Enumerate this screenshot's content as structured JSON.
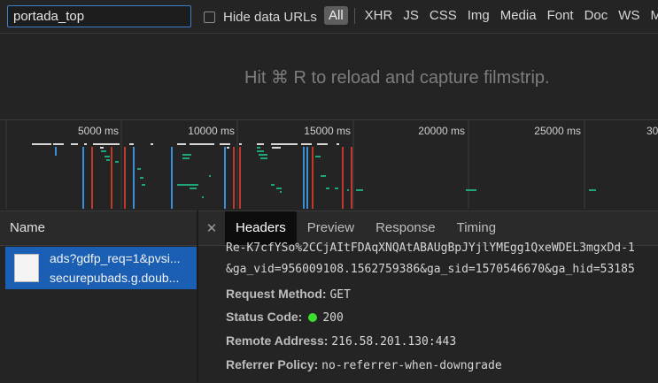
{
  "filter": {
    "value": "portada_top"
  },
  "hide_data_urls": {
    "label": "Hide data URLs",
    "checked": false
  },
  "resource_types": [
    "All",
    "XHR",
    "JS",
    "CSS",
    "Img",
    "Media",
    "Font",
    "Doc",
    "WS",
    "M"
  ],
  "filmstrip": {
    "message": "Hit ⌘ R to reload and capture filmstrip."
  },
  "timeline": {
    "ticks": [
      "5000 ms",
      "10000 ms",
      "15000 ms",
      "20000 ms",
      "25000 ms",
      "30"
    ]
  },
  "request_list": {
    "header": "Name",
    "selected": {
      "name": "ads?gdfp_req=1&pvsi...",
      "domain": "securepubads.g.doub..."
    }
  },
  "tabs": [
    "Headers",
    "Preview",
    "Response",
    "Timing"
  ],
  "active_tab": "Headers",
  "headers": {
    "url_fragment_1": "Re-K7cfYSo%2CCjAItFDAqXNQAtABAUgBpJYjlYMEgg1QxeWDEL3mgxDd-1",
    "url_fragment_2": "&ga_vid=956009108.1562759386&ga_sid=1570546670&ga_hid=53185",
    "request_method": {
      "label": "Request Method:",
      "value": "GET"
    },
    "status_code": {
      "label": "Status Code:",
      "value": "200"
    },
    "remote_address": {
      "label": "Remote Address:",
      "value": "216.58.201.130:443"
    },
    "referrer_policy": {
      "label": "Referrer Policy:",
      "value": "no-referrer-when-downgrade"
    }
  }
}
